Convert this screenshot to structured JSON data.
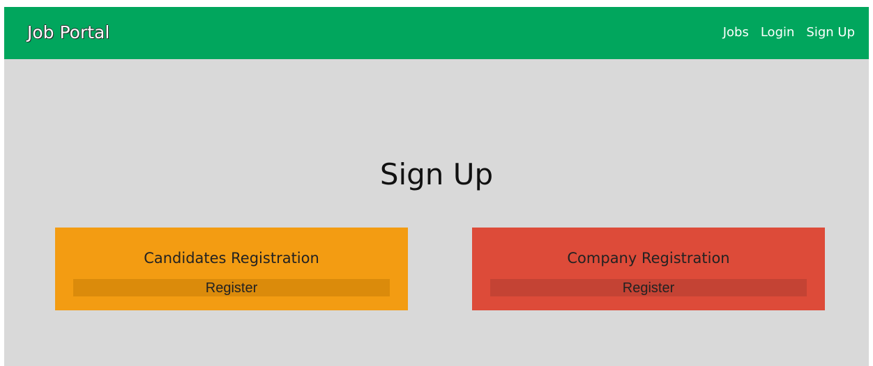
{
  "navbar": {
    "brand": "Job Portal",
    "links": [
      {
        "label": "Jobs"
      },
      {
        "label": "Login"
      },
      {
        "label": "Sign Up"
      }
    ],
    "color": "#01a65d"
  },
  "main": {
    "title": "Sign Up",
    "background": "#d9d9d9",
    "cards": [
      {
        "title": "Candidates Registration",
        "button": "Register",
        "color": "#f39c12"
      },
      {
        "title": "Company Registration",
        "button": "Register",
        "color": "#dd4b39"
      }
    ]
  }
}
